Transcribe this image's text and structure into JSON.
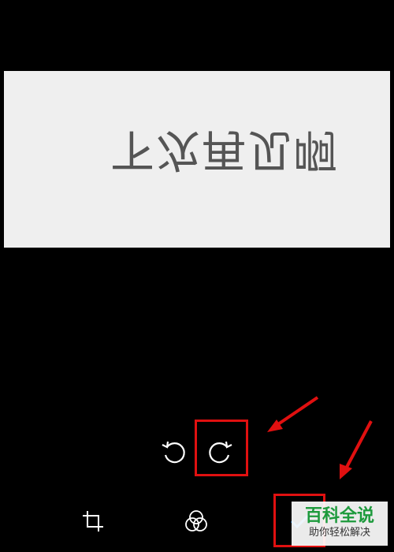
{
  "photo": {
    "text": "下次再见啊"
  },
  "toolbar": {
    "rotate_left_icon": "rotate-left-icon",
    "rotate_right_icon": "rotate-right-icon"
  },
  "bottom_bar": {
    "crop_icon": "crop-icon",
    "filter_icon": "filter-icon",
    "confirm_icon": "confirm-icon"
  },
  "annotations": {
    "color": "#e01010"
  },
  "watermark": {
    "title": "百科全说",
    "subtitle": "助你轻松解决"
  }
}
